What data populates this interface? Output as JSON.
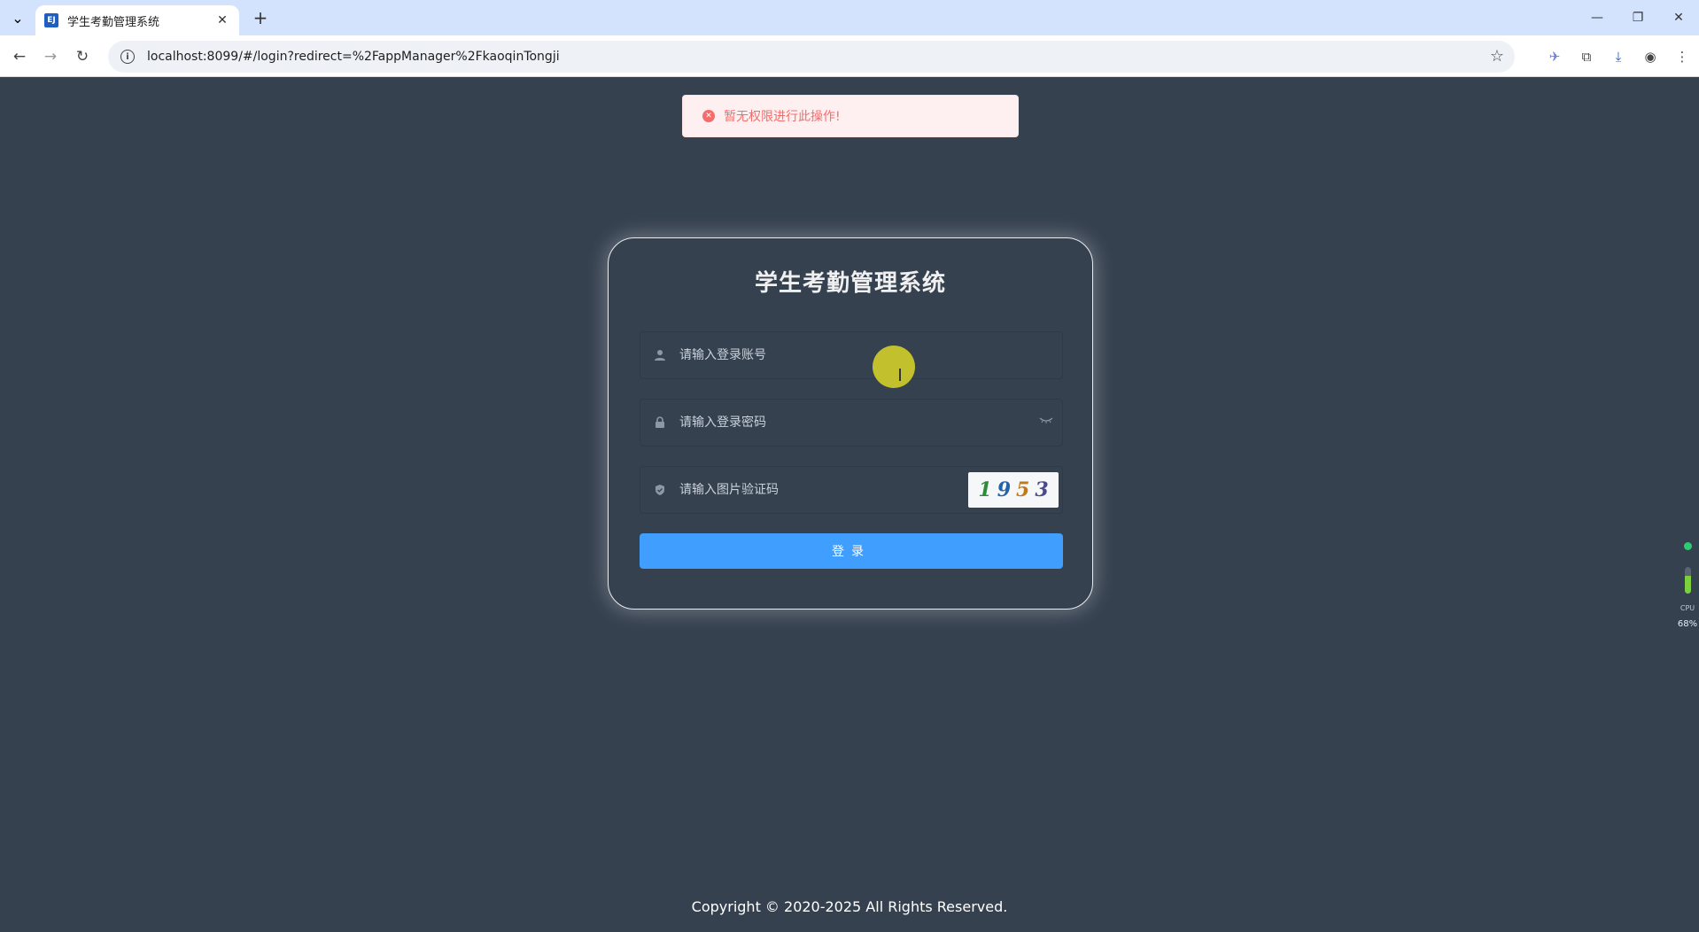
{
  "browser": {
    "tab_title": "学生考勤管理系统",
    "tab_favicon": "EJ",
    "url": "localhost:8099/#/login?redirect=%2FappManager%2FkaoqinTongji"
  },
  "message": {
    "text": "暂无权限进行此操作!",
    "type": "error",
    "color": "#f56c6c"
  },
  "login": {
    "title": "学生考勤管理系统",
    "account_placeholder": "请输入登录账号",
    "password_placeholder": "请输入登录密码",
    "captcha_placeholder": "请输入图片验证码",
    "captcha_chars": [
      "1",
      "9",
      "5",
      "3"
    ],
    "captcha_colors": [
      "#2e8b3a",
      "#2563a8",
      "#c07a1a",
      "#4a4a8a"
    ],
    "submit_label": "登录",
    "accent_color": "#409eff"
  },
  "footer": {
    "copyright": "Copyright © 2020-2025 All Rights Reserved."
  },
  "cpu_widget": {
    "label": "CPU",
    "value": "68%",
    "percent": 68
  }
}
